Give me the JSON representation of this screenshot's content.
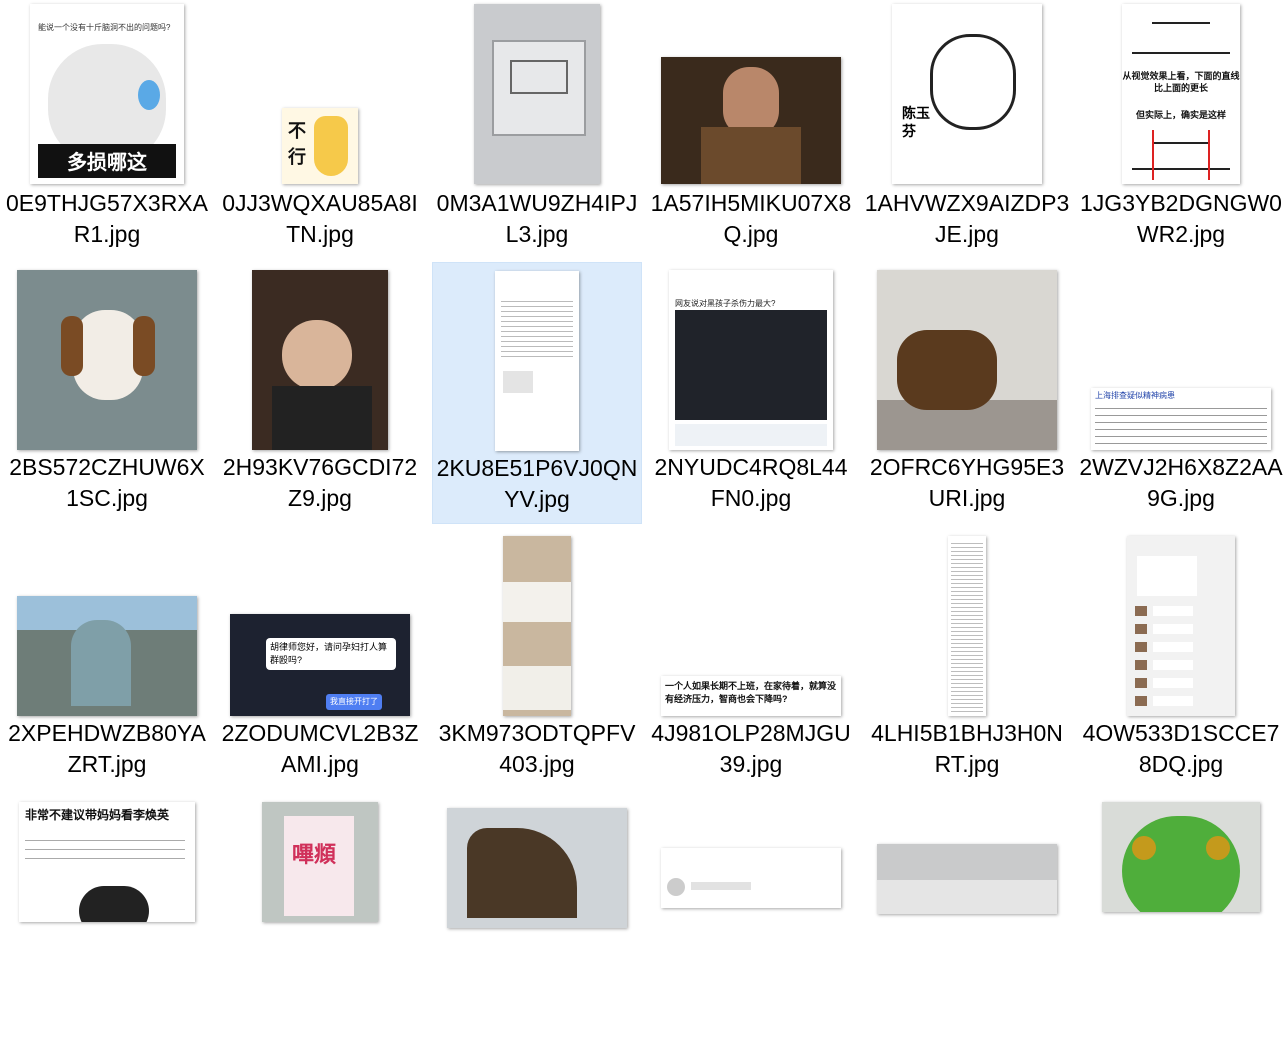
{
  "files": [
    {
      "name": "0E9THJG57X3RXAR1.jpg",
      "caption": "多损哪这",
      "header": "能说一个没有十斤脑洞不出的问题吗?"
    },
    {
      "name": "0JJ3WQXAU85A8ITN.jpg",
      "caption": "不行"
    },
    {
      "name": "0M3A1WU9ZH4IPJL3.jpg"
    },
    {
      "name": "1A57IH5MIKU07X8Q.jpg"
    },
    {
      "name": "1AHVWZX9AIZDP3JE.jpg",
      "caption": "陈玉芬"
    },
    {
      "name": "1JG3YB2DGNGW0WR2.jpg",
      "caption": "从视觉效果上看，下面的直线比上面的更长",
      "caption2": "但实际上，确实是这样"
    },
    {
      "name": "2BS572CZHUW6X1SC.jpg"
    },
    {
      "name": "2H93KV76GCDI72Z9.jpg"
    },
    {
      "name": "2KU8E51P6VJ0QNYV.jpg",
      "selected": true
    },
    {
      "name": "2NYUDC4RQ8L44FN0.jpg",
      "caption": "网友说对黑孩子杀伤力最大?"
    },
    {
      "name": "2OFRC6YHG95E3URI.jpg"
    },
    {
      "name": "2WZVJ2H6X8Z2AA9G.jpg",
      "caption": "上海排查疑似精神病患"
    },
    {
      "name": "2XPEHDWZB80YAZRT.jpg"
    },
    {
      "name": "2ZODUMCVL2B3ZAMI.jpg",
      "caption": "胡律师您好，请问孕妇打人算群殴吗?",
      "caption2": "我直接开打了"
    },
    {
      "name": "3KM973ODTQPFV403.jpg"
    },
    {
      "name": "4J981OLP28MJGU39.jpg",
      "caption": "一个人如果长期不上班，在家待着，就算没有经济压力，智商也会下降吗?"
    },
    {
      "name": "4LHI5B1BHJ3H0NRT.jpg"
    },
    {
      "name": "4OW533D1SCCE78DQ.jpg"
    },
    {
      "name": "",
      "caption": "非常不建议带妈妈看李焕英"
    },
    {
      "name": "",
      "caption": "嗶頫"
    },
    {
      "name": ""
    },
    {
      "name": ""
    },
    {
      "name": ""
    },
    {
      "name": ""
    }
  ]
}
